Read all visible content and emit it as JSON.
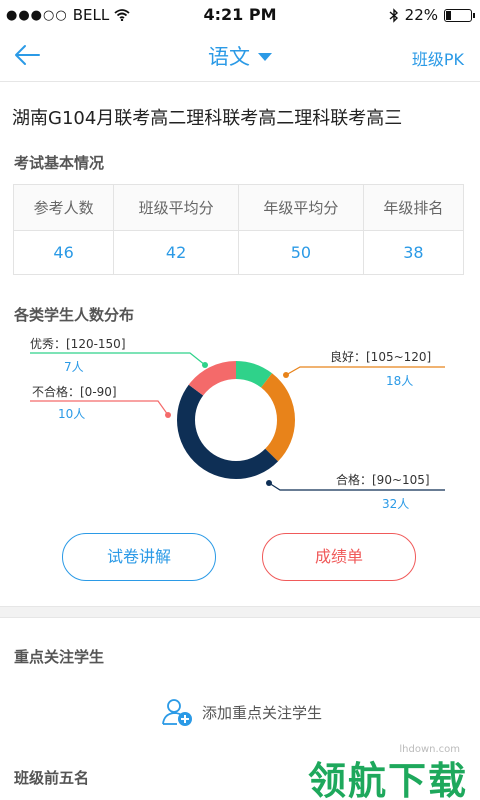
{
  "status_bar": {
    "carrier": "BELL",
    "time": "4:21 PM",
    "battery": "22%",
    "battery_level": 0.22
  },
  "nav": {
    "title": "语文",
    "pk_label": "班级PK"
  },
  "exam": {
    "title": "湖南G104月联考高二理科联考高二理科联考高三"
  },
  "basic_info": {
    "section_title": "考试基本情况",
    "headers": [
      "参考人数",
      "班级平均分",
      "年级平均分",
      "年级排名"
    ],
    "values": [
      "46",
      "42",
      "50",
      "38"
    ]
  },
  "distribution": {
    "section_title": "各类学生人数分布",
    "segments": [
      {
        "label": "优秀：[120-150]",
        "count": "7人",
        "value": 7,
        "color": "#2fd28a"
      },
      {
        "label": "良好：[105~120]",
        "count": "18人",
        "value": 18,
        "color": "#e8831a"
      },
      {
        "label": "合格：[90~105]",
        "count": "32人",
        "value": 32,
        "color": "#0e2f55"
      },
      {
        "label": "不合格：[0-90]",
        "count": "10人",
        "value": 10,
        "color": "#f46a6a"
      }
    ]
  },
  "chart_data": {
    "type": "pie",
    "categories": [
      "优秀：[120-150]",
      "良好：[105~120]",
      "合格：[90~105]",
      "不合格：[0-90]"
    ],
    "values": [
      7,
      18,
      32,
      10
    ],
    "colors": [
      "#2fd28a",
      "#e8831a",
      "#0e2f55",
      "#f46a6a"
    ],
    "style": "donut"
  },
  "buttons": {
    "explain": "试卷讲解",
    "report": "成绩单"
  },
  "focus": {
    "section_title": "重点关注学生",
    "add_label": "添加重点关注学生"
  },
  "top5": {
    "section_title": "班级前五名"
  },
  "watermark": {
    "url": "lhdown.com",
    "text": "领航下载"
  }
}
